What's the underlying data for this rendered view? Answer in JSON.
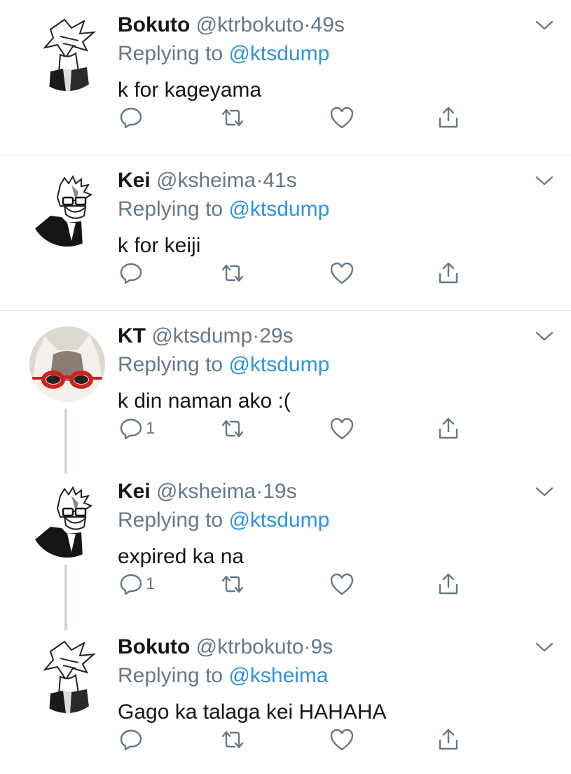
{
  "tweets": [
    {
      "name": "Bokuto",
      "handle": "@ktrbokuto",
      "dot": "·",
      "time": "49s",
      "replying_prefix": "Replying to",
      "replying_to": "@ktsdump",
      "text": "k for kageyama",
      "reply_count": "",
      "avatar_icon": "manga-boy-avatar"
    },
    {
      "name": "Kei",
      "handle": "@ksheima",
      "dot": "·",
      "time": "41s",
      "replying_prefix": "Replying to",
      "replying_to": "@ktsdump",
      "text": "k for keiji",
      "reply_count": "",
      "avatar_icon": "manga-glasses-avatar"
    },
    {
      "name": "KT",
      "handle": "@ktsdump",
      "dot": "·",
      "time": "29s",
      "replying_prefix": "Replying to",
      "replying_to": "@ktsdump",
      "text": "k din naman ako :(",
      "reply_count": "1",
      "avatar_icon": "cat-sunglasses-avatar"
    },
    {
      "name": "Kei",
      "handle": "@ksheima",
      "dot": "·",
      "time": "19s",
      "replying_prefix": "Replying to",
      "replying_to": "@ktsdump",
      "text": "expired ka na",
      "reply_count": "1",
      "avatar_icon": "manga-glasses-avatar"
    },
    {
      "name": "Bokuto",
      "handle": "@ktrbokuto",
      "dot": "·",
      "time": "9s",
      "replying_prefix": "Replying to",
      "replying_to": "@ksheima",
      "text": "Gago ka talaga kei HAHAHA",
      "reply_count": "",
      "avatar_icon": "manga-boy-avatar"
    }
  ],
  "colors": {
    "link": "#2d92e0",
    "secondary_text": "#667886",
    "icon": "#667886",
    "separator": "#e1e5e8",
    "thread_line": "#ccd6dd"
  }
}
